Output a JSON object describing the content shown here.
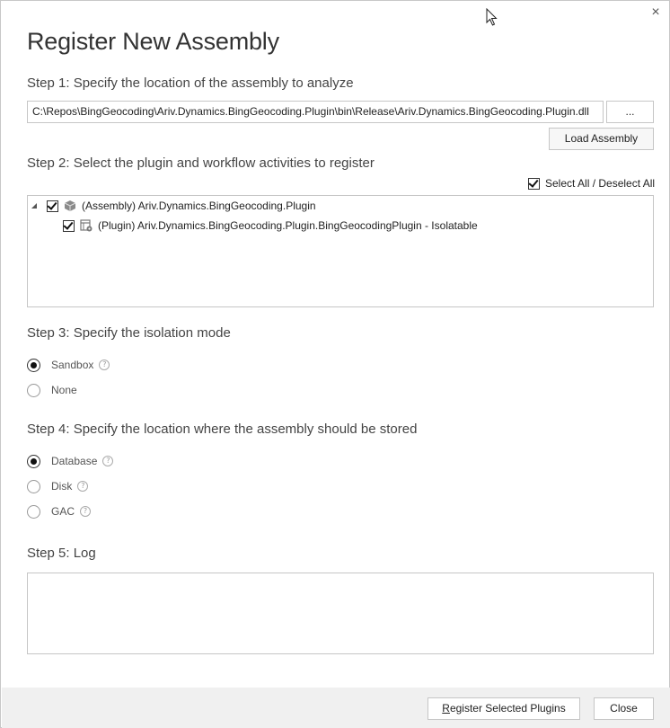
{
  "window": {
    "title": "Register New Assembly",
    "close_glyph": "×"
  },
  "step1": {
    "label": "Step 1: Specify the location of the assembly to analyze",
    "path_value": "C:\\Repos\\BingGeocoding\\Ariv.Dynamics.BingGeocoding.Plugin\\bin\\Release\\Ariv.Dynamics.BingGeocoding.Plugin.dll",
    "browse_label": "...",
    "load_label": "Load Assembly"
  },
  "step2": {
    "label": "Step 2: Select the plugin and workflow activities to register",
    "select_all_label": "Select All / Deselect All",
    "select_all_checked": true,
    "tree": [
      {
        "label": "(Assembly) Ariv.Dynamics.BingGeocoding.Plugin",
        "checked": true,
        "icon": "assembly-icon",
        "expanded": true
      },
      {
        "label": "(Plugin) Ariv.Dynamics.BingGeocoding.Plugin.BingGeocodingPlugin - Isolatable",
        "checked": true,
        "icon": "plugin-icon"
      }
    ]
  },
  "step3": {
    "label": "Step 3: Specify the isolation mode",
    "options": [
      {
        "label": "Sandbox",
        "selected": true,
        "help": true
      },
      {
        "label": "None",
        "selected": false,
        "help": false
      }
    ]
  },
  "step4": {
    "label": "Step 4: Specify the location where the assembly should be stored",
    "options": [
      {
        "label": "Database",
        "selected": true,
        "help": true
      },
      {
        "label": "Disk",
        "selected": false,
        "help": true
      },
      {
        "label": "GAC",
        "selected": false,
        "help": true
      }
    ]
  },
  "step5": {
    "label": "Step 5: Log",
    "log_text": ""
  },
  "footer": {
    "register_label_prefix": "R",
    "register_label_rest": "egister Selected Plugins",
    "close_label": "Close"
  },
  "help_glyph": "?",
  "colors": {
    "footer_bg": "#f0f0f0",
    "border": "#c6c6c6",
    "text": "#333333"
  }
}
